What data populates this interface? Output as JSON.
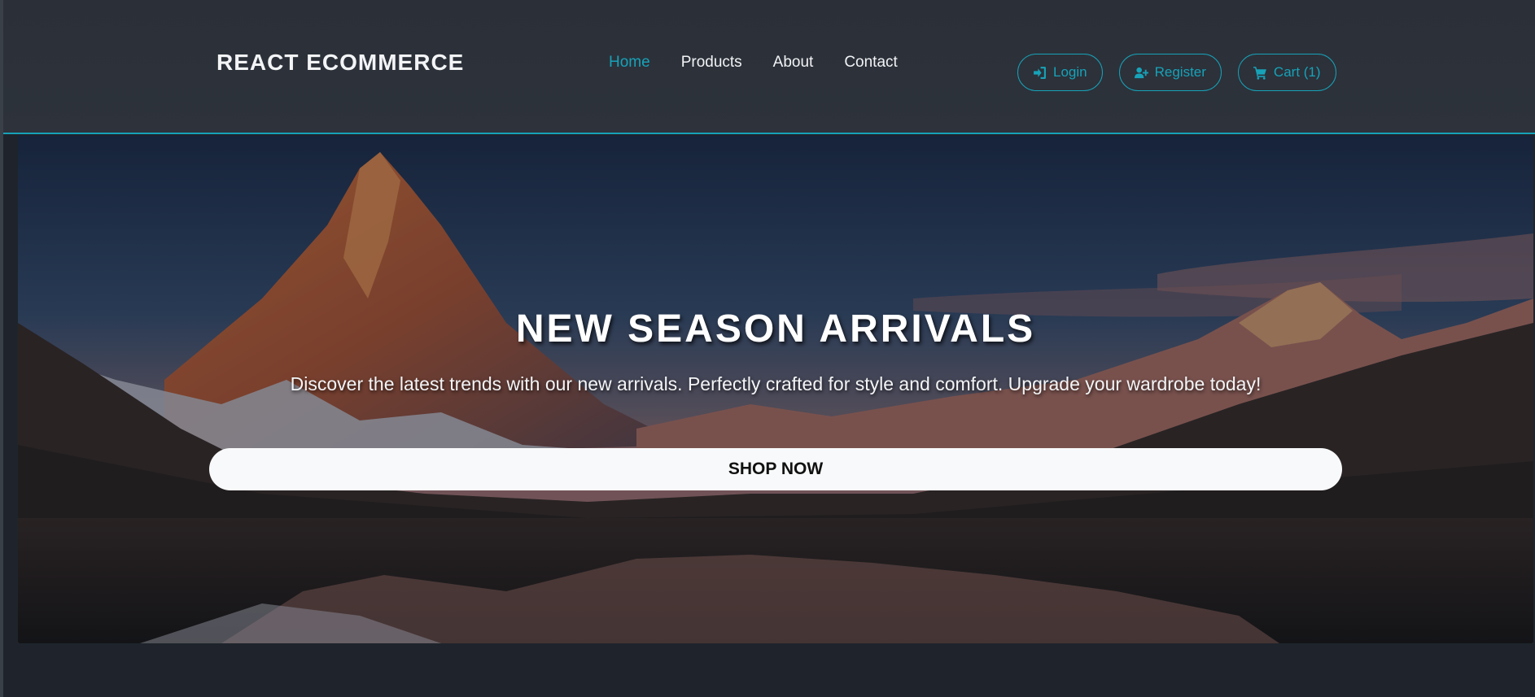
{
  "navbar": {
    "brand": "REACT ECOMMERCE",
    "links": [
      {
        "label": "Home",
        "active": true
      },
      {
        "label": "Products",
        "active": false
      },
      {
        "label": "About",
        "active": false
      },
      {
        "label": "Contact",
        "active": false
      }
    ],
    "buttons": {
      "login": {
        "label": "Login",
        "icon": "sign-in-icon"
      },
      "register": {
        "label": "Register",
        "icon": "user-plus-icon"
      },
      "cart": {
        "label": "Cart (1)",
        "icon": "shopping-cart-icon"
      }
    }
  },
  "hero": {
    "title": "NEW SEASON ARRIVALS",
    "subtitle": "Discover the latest trends with our new arrivals. Perfectly crafted for style and comfort. Upgrade your wardrobe today!",
    "cta_label": "SHOP NOW"
  },
  "colors": {
    "accent": "#17a2b8",
    "navbar_bg": "#2b3038",
    "page_bg": "#1f242c",
    "cta_bg": "#f8f9fa"
  }
}
